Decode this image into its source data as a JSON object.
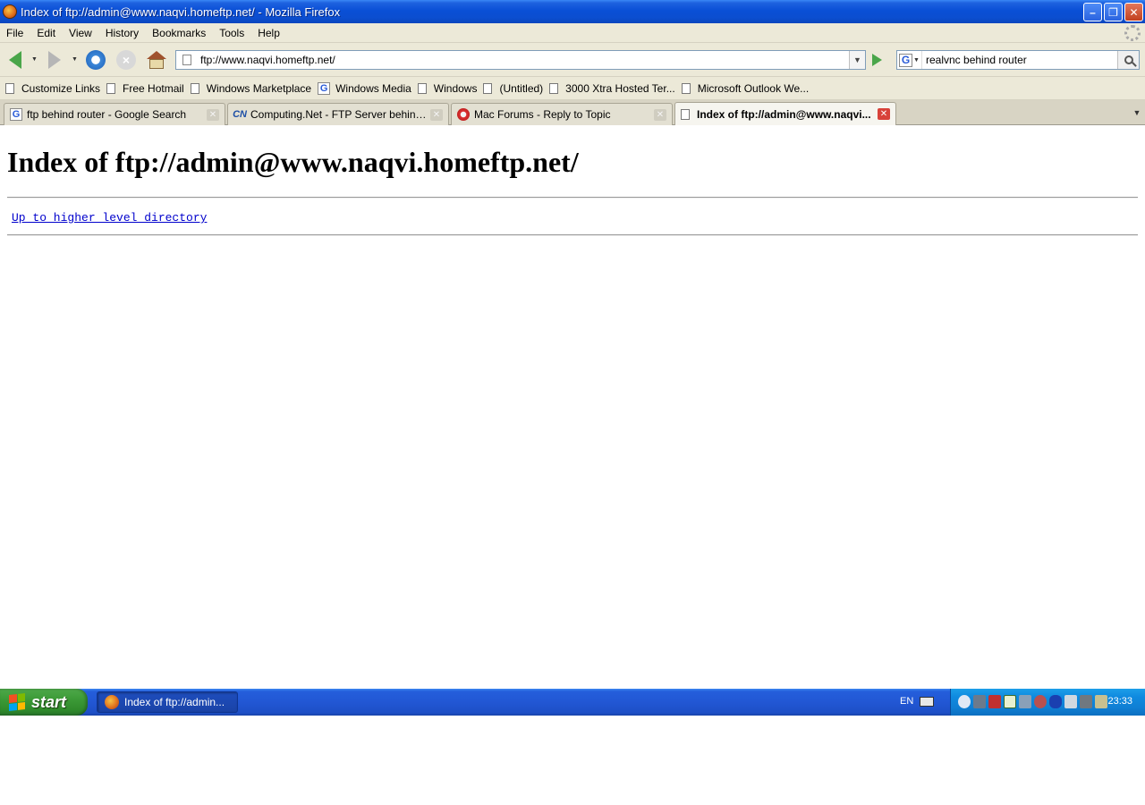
{
  "window": {
    "title": "Index of ftp://admin@www.naqvi.homeftp.net/ - Mozilla Firefox",
    "minimize": "–",
    "restore": "❐",
    "close": "✕"
  },
  "menu": [
    "File",
    "Edit",
    "View",
    "History",
    "Bookmarks",
    "Tools",
    "Help"
  ],
  "navigation": {
    "url": "ftp://www.naqvi.homeftp.net/",
    "search_engine": "G",
    "search_query": "realvnc behind router"
  },
  "bookmarks": [
    {
      "label": "Customize Links",
      "icon": "page-icon"
    },
    {
      "label": "Free Hotmail",
      "icon": "page-icon"
    },
    {
      "label": "Windows Marketplace",
      "icon": "page-icon"
    },
    {
      "label": "Windows Media",
      "icon": "google-icon"
    },
    {
      "label": "Windows",
      "icon": "page-icon"
    },
    {
      "label": "(Untitled)",
      "icon": "page-icon"
    },
    {
      "label": "3000 Xtra Hosted Ter...",
      "icon": "page-icon"
    },
    {
      "label": "Microsoft Outlook We...",
      "icon": "page-icon"
    }
  ],
  "tabs": [
    {
      "label": "ftp behind router - Google Search",
      "icon": "google-icon",
      "active": false
    },
    {
      "label": "Computing.Net - FTP Server behind ro...",
      "icon": "computing-net-icon",
      "active": false
    },
    {
      "label": "Mac Forums - Reply to Topic",
      "icon": "mac-forums-icon",
      "active": false
    },
    {
      "label": "Index of ftp://admin@www.naqvi...",
      "icon": "page-icon",
      "active": true
    }
  ],
  "page": {
    "heading": "Index of ftp://admin@www.naqvi.homeftp.net/",
    "up_link": "Up to higher level directory",
    "link_color": "#0000cc"
  },
  "taskbar": {
    "start_label": "start",
    "task_label": "Index of ftp://admin...",
    "language": "EN",
    "clock": "23:33"
  },
  "colors": {
    "titlebar": "#0a4fd6",
    "chrome": "#ece9d8",
    "start_button": "#3c9a37",
    "tray": "#0f8ae0"
  }
}
